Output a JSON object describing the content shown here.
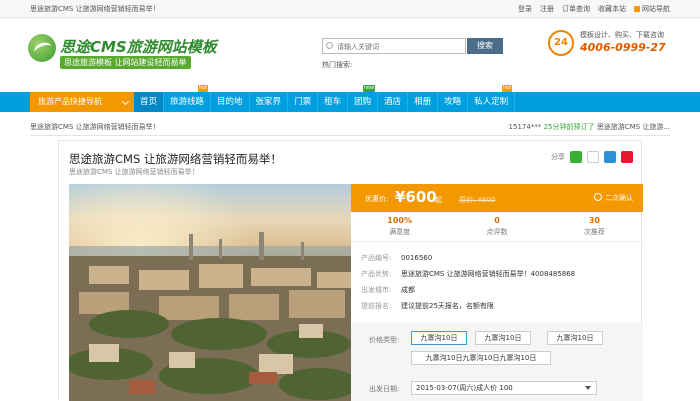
{
  "topbar": {
    "welcome": "思途旅游CMS 让旅游网络营销轻而易举！",
    "links": [
      "登录",
      "注册",
      "订单查询",
      "收藏本站",
      "网站导航"
    ]
  },
  "header": {
    "logo_name": "思途CMS旅游网站模板",
    "logo_slogan": "思途旅游模板 让网站建设轻而易举",
    "search_placeholder": "请输入关键词",
    "search_button": "搜索",
    "hot_label": "热门搜索:",
    "hotline_badge": "24",
    "hotline_desc": "模板设计、购买、下载咨询",
    "hotline_phone": "4006-0999-27"
  },
  "nav": {
    "quick": "旅游产品快捷导航",
    "items": [
      {
        "label": "首页",
        "tag": ""
      },
      {
        "label": "旅游线路",
        "tag": "hot"
      },
      {
        "label": "目的地",
        "tag": ""
      },
      {
        "label": "张家界",
        "tag": ""
      },
      {
        "label": "门票",
        "tag": ""
      },
      {
        "label": "租车",
        "tag": ""
      },
      {
        "label": "团购",
        "tag": "new"
      },
      {
        "label": "酒店",
        "tag": ""
      },
      {
        "label": "相册",
        "tag": ""
      },
      {
        "label": "攻略",
        "tag": ""
      },
      {
        "label": "私人定制",
        "tag": "hot"
      }
    ]
  },
  "breadcrumb": {
    "left": "思途旅游CMS 让旅游网络营销轻而易举！",
    "right_id": "15174***",
    "right_time": "25分钟前预订了",
    "right_title": "思途旅游CMS 让旅游..."
  },
  "product": {
    "title": "思途旅游CMS 让旅游网络营销轻而易举！",
    "subtitle": "思途旅游CMS 让旅游网络营销轻而易举！",
    "share_label": "分享",
    "price_label": "优惠价:",
    "price": "¥600",
    "price_from": "起",
    "orig_price": "原价: ¥800",
    "confirm": "二次确认",
    "stats": [
      {
        "value": "100%",
        "label": "满意度"
      },
      {
        "value": "0",
        "label": "点评数"
      },
      {
        "value": "30",
        "label": "次推荐"
      }
    ],
    "info": [
      {
        "key": "产品编号:",
        "value": "0016560"
      },
      {
        "key": "产品优势:",
        "value": "思途旅游CMS 让旅游网络营销轻而易举！4008485868"
      },
      {
        "key": "出发城市:",
        "value": "成都"
      },
      {
        "key": "提前报名:",
        "value": "建议提前25天报名，名额有限"
      }
    ],
    "price_type_label": "价格类型:",
    "price_types": [
      "九寨沟10日",
      "九寨沟10日",
      "九寨沟10日",
      "九寨沟10日九寨沟10日九寨沟10日"
    ],
    "date_label": "出发日期:",
    "date_value": "2015-03-07(周六)成人价 100"
  },
  "colors": {
    "nav": "#00a0e0",
    "accent": "#f39800",
    "green": "#3aa53a"
  }
}
